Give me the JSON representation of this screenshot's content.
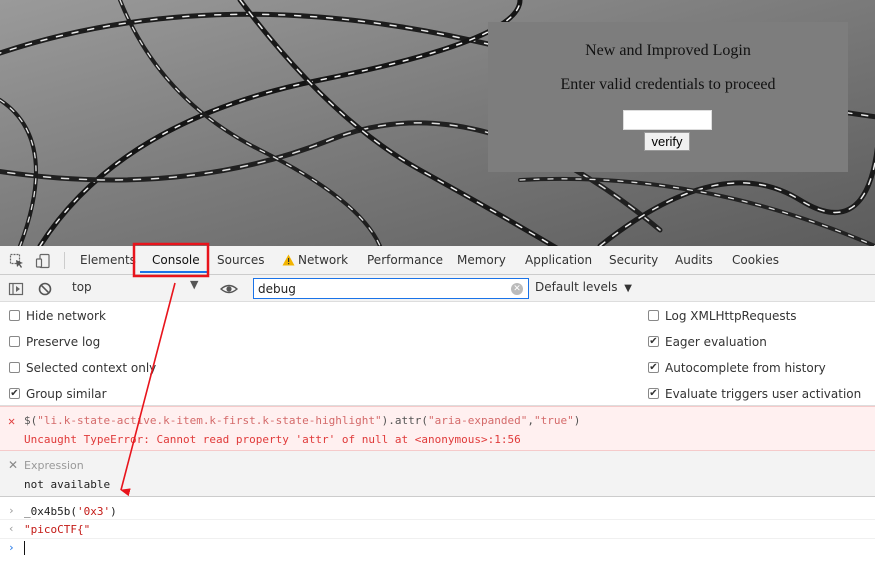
{
  "page": {
    "login_title": "New and Improved Login",
    "login_subtitle": "Enter valid credentials to proceed",
    "input_value": "",
    "verify_label": "verify"
  },
  "devtools": {
    "tabs": [
      {
        "label": "Elements"
      },
      {
        "label": "Console",
        "active": true
      },
      {
        "label": "Sources"
      },
      {
        "label": "Network",
        "warning_icon": "warning-icon"
      },
      {
        "label": "Performance"
      },
      {
        "label": "Memory"
      },
      {
        "label": "Application"
      },
      {
        "label": "Security"
      },
      {
        "label": "Audits"
      },
      {
        "label": "Cookies"
      }
    ],
    "toolbar": {
      "context": "top",
      "filter_value": "debug",
      "levels": "Default levels"
    },
    "settings": {
      "left": [
        {
          "label": "Hide network",
          "checked": false
        },
        {
          "label": "Preserve log",
          "checked": false
        },
        {
          "label": "Selected context only",
          "checked": false
        },
        {
          "label": "Group similar",
          "checked": true
        }
      ],
      "right": [
        {
          "label": "Log XMLHttpRequests",
          "checked": false
        },
        {
          "label": "Eager evaluation",
          "checked": true
        },
        {
          "label": "Autocomplete from history",
          "checked": true
        },
        {
          "label": "Evaluate triggers user activation",
          "checked": true
        }
      ]
    },
    "console": {
      "error_command_prefix": "$(",
      "error_command_selector": "\"li.k-state-active.k-item.k-first.k-state-highlight\"",
      "error_command_mid": ").attr(",
      "error_command_arg1": "\"aria-expanded\"",
      "error_command_comma": ",",
      "error_command_arg2": "\"true\"",
      "error_command_suffix": ")",
      "error_message": "Uncaught TypeError: Cannot read property 'attr' of null at <anonymous>:1:56",
      "expression_label": "Expression",
      "expression_value": "not available",
      "command_fn": "_0x4b5b(",
      "command_arg": "'0x3'",
      "command_close": ")",
      "result": "\"picoCTF{\""
    }
  },
  "colors": {
    "accent": "#1a73e8",
    "annotation": "#e8141c",
    "error_bg": "#fff0f0",
    "error_text": "#e03a3a"
  }
}
